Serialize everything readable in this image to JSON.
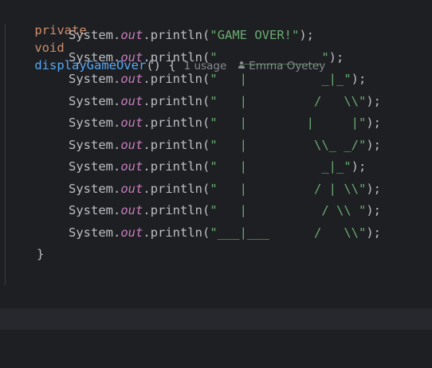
{
  "signature": {
    "modifier": "private",
    "return_type": "void",
    "method_name": "displayGameOver",
    "params": "()",
    "open_brace": "{"
  },
  "hints": {
    "usage": "1 usage",
    "author": "Emma Oyetey"
  },
  "print_call": {
    "class_name": "System",
    "dot1": ".",
    "field": "out",
    "dot2": ".",
    "method": "println",
    "open_paren": "(",
    "close": ");"
  },
  "lines": [
    {
      "text": "\"GAME OVER!\""
    },
    {
      "text": "\"   ___________\""
    },
    {
      "text": "\"   |          _|_\""
    },
    {
      "text": "\"   |         /   \\\\\""
    },
    {
      "text": "\"   |        |     |\""
    },
    {
      "text": "\"   |         \\\\_ _/\""
    },
    {
      "text": "\"   |          _|_\""
    },
    {
      "text": "\"   |         / | \\\\\""
    },
    {
      "text": "\"   |          / \\\\ \""
    },
    {
      "text": "\"___|___      /   \\\\\""
    }
  ],
  "closing_brace": "}",
  "colors": {
    "background": "#1e1f22",
    "keyword": "#cf8e6d",
    "method_name": "#56a8f5",
    "string": "#6aab73",
    "field": "#c77dbb",
    "default_text": "#bcbec4",
    "hint": "#868a91",
    "current_line": "#26282e"
  }
}
